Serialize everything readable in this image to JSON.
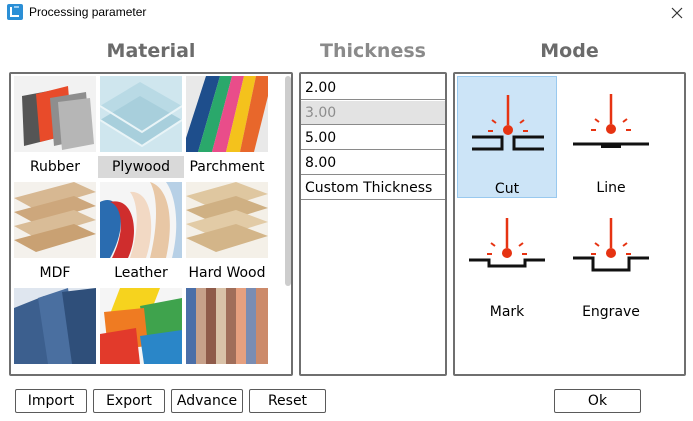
{
  "window": {
    "title": "Processing parameter"
  },
  "headings": {
    "material": "Material",
    "thickness": "Thickness",
    "mode": "Mode"
  },
  "materials": [
    {
      "label": "Rubber"
    },
    {
      "label": "Plywood",
      "selected": true
    },
    {
      "label": "Parchment"
    },
    {
      "label": "MDF"
    },
    {
      "label": "Leather"
    },
    {
      "label": "Hard Wood"
    },
    {
      "label": ""
    },
    {
      "label": ""
    },
    {
      "label": ""
    }
  ],
  "thickness": {
    "items": [
      {
        "label": "2.00"
      },
      {
        "label": "3.00",
        "selected": true
      },
      {
        "label": "5.00"
      },
      {
        "label": "8.00"
      },
      {
        "label": "Custom Thickness"
      }
    ]
  },
  "modes": [
    {
      "label": "Cut",
      "selected": true
    },
    {
      "label": "Line"
    },
    {
      "label": "Mark"
    },
    {
      "label": "Engrave"
    }
  ],
  "buttons": {
    "import": "Import",
    "export": "Export",
    "advance": "Advance",
    "reset": "Reset",
    "ok": "Ok"
  },
  "colors": {
    "laser": "#e63312",
    "selection_blue": "#cce4f7",
    "heading_gray": "#6b6b6b"
  }
}
